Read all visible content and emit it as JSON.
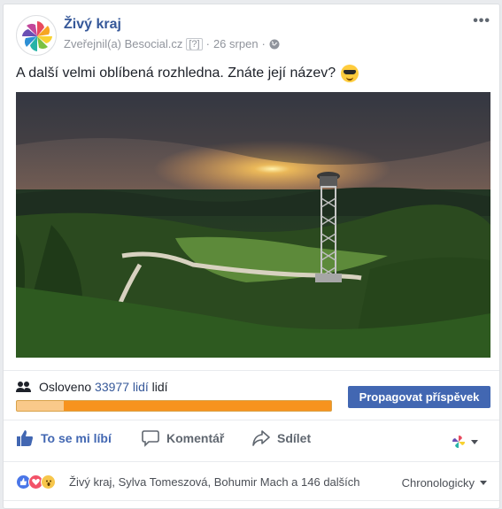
{
  "post": {
    "page_name": "Živý kraj",
    "published_by": "Zveřejnil(a) Besocial.cz",
    "help_marker": "[?]",
    "separator": "·",
    "date": "26 srpen",
    "audience_icon": "globe-icon",
    "more_label": "•••",
    "text": "A další velmi oblíbená rozhledna. Znáte její název?",
    "text_emoji": "sunglasses-emoji"
  },
  "reach": {
    "prefix": "Osloveno",
    "count": "33977 lidí",
    "suffix": "lidí",
    "progress_fraction": 0.15,
    "promote_label": "Propagovat příspěvek"
  },
  "actions": {
    "like_label": "To se mi líbí",
    "comment_label": "Komentář",
    "share_label": "Sdílet"
  },
  "reactions": {
    "names": "Živý kraj, Sylva Tomeszová, Bohumir Mach a 146 dalších",
    "sort_label": "Chronologicky"
  },
  "colors": {
    "link": "#365899",
    "accent": "#4267b2",
    "progress_orange": "#f7931e"
  }
}
